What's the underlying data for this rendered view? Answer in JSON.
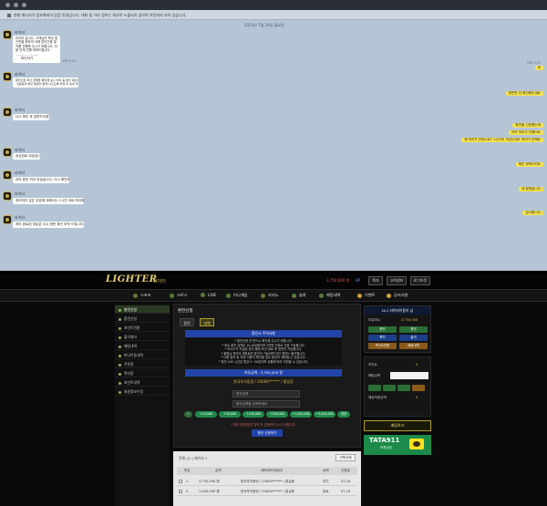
{
  "chat": {
    "notice": "현재 메시지가 암호화되어 있음 한글입니다. 대화 및 기타 정보는 외부로 누출되지 않으며 보안처리 되어 있습니다.",
    "date": "2023년 7월 24일 월요일",
    "sender": "라이터",
    "card_text": "라이터 입니다. 고객님의 보안 및 안전을 위하여 아래 본인인증 절차를 진행해 주시기 바랍니다. 다음 단계 진행 부탁드립니다.",
    "card_button": "확인하기",
    "incoming": [
      "라이터 입니다. 회원님 보안강화\n안전한 이용을 위하여 본인확인\n(신분증)이 필요합니다. 신분증을 촬영하여\n보내주시면 확인 후 처리됩니다.",
      "환전신청 하신 금액을 확인해 보니 처리 중 본인 확인이 필요합니다.\n 신분증과 본인 얼굴이 함께 나오도록 촬영 후 보내 주세요.",
      "다시 확인 후 답변드리겠습니다.",
      "송금완료 되었습니다.",
      "이미 환전 처리 되었습니다. 다시 확인해 주세요.",
      "처리하지 않은 부분에 대해서는 1시간 이내 처리해 드리겠습니다.",
      "처리 완료된 부분은 다시 한번 확인 부탁 드립니다."
    ],
    "outgoing": [
      "네",
      "한번만 더 확인해주세요",
      "환전을 신청했는데",
      "아직 처리가 안됐어요",
      "왜 처리가 안되나요? 1시간이 지났는데도 처리가 안돼요",
      "확인 부탁드려요",
      "네 알겠습니다",
      "감사합니다",
      "네"
    ],
    "time_in": "오후 3:10",
    "time_out": "오후 3:15"
  },
  "site": {
    "logo": "LIGHTER",
    "logo_sub": "라이터",
    "header_points": "3,750,000 원",
    "header_cash": "0P",
    "header_buttons": [
      "쪽지",
      "고객센터",
      "로그아웃"
    ],
    "nav": [
      "스포츠",
      "크로스",
      "LIVE",
      "미니게임",
      "카지노",
      "슬롯",
      "배팅내역",
      "이벤트",
      "공지사항"
    ],
    "sidebar": [
      "충전신청",
      "환전신청",
      "포인트전환",
      "출석체크",
      "베팅내역",
      "머니이동내역",
      "쿠폰함",
      "쪽지함",
      "포인트내역",
      "회원정보수정"
    ],
    "main": {
      "title": "환전신청",
      "tabs": [
        "환전",
        "내역"
      ],
      "info": "환전시 주의사항",
      "rules": "* 환전신청 전 반드시 확인해 주시기 바랍니다.\n* 최소 환전 금액은 10,000원이며 1만원 단위로 신청 가능합니다.\n* 보너스가 지급된 경우 롤링 조건 완료 후 환전이 가능합니다.\n* 회원님 명의의 계좌로만 환전이 가능하며 타인 명의는 불가합니다.\n* 다중 접속 및 부정 이용이 확인될 경우 환전이 제한될 수 있습니다.\n* 환전 소요 시간은 평균 5~30분이며 상황에 따라 지연될 수 있습니다.",
      "amount_header": "보유금액 : 3,750,000 원",
      "amount_line": "한국투자증권 / 24000****** / 홍길동",
      "selects": [
        "환전금액",
        "환전금액을 입력하세요"
      ],
      "pills": [
        "+",
        "+10,000",
        "+50,000",
        "+100,000",
        "+500,000",
        "+1,000,000",
        "+3,000,000",
        "정정"
      ],
      "note": "* 환전 비밀번호를 입력 후 신청하여 주시기 바랍니다.",
      "apply": "환전 신청하기"
    },
    "list": {
      "top": "전체 (2) | 페이지 1",
      "button": "선택삭제",
      "headers": [
        "번호",
        "금액",
        "계좌정보/예금주",
        "상태",
        "신청일"
      ],
      "rows": [
        [
          "1",
          "3,750,000 원",
          "한국투자증권 / 24000****** / 홍길동",
          "대기",
          "07-24"
        ],
        [
          "2",
          "1,000,000 원",
          "한국투자증권 / 24000****** / 홍길동",
          "완료",
          "07-23"
        ]
      ]
    },
    "right": {
      "header": "LV.1  라이터이용자 님",
      "labels": [
        "보유머니",
        "포인트",
        "베팅금액",
        "예상적중금액"
      ],
      "values": [
        "3,750,000",
        "0",
        "5,000",
        "0"
      ],
      "buttons": [
        "충전",
        "환전",
        "쪽지",
        "출석",
        "포인트전환",
        "배팅내역"
      ],
      "bet_now": "배팅하기",
      "tata": "TATA911",
      "tata_sub": "카톡상담"
    },
    "colors": {
      "accent": "#e8d27a",
      "green": "#2b6e35",
      "blue": "#2244aa",
      "chat_bg": "#b6c5d6",
      "bubble_out": "#f5e34a"
    }
  }
}
